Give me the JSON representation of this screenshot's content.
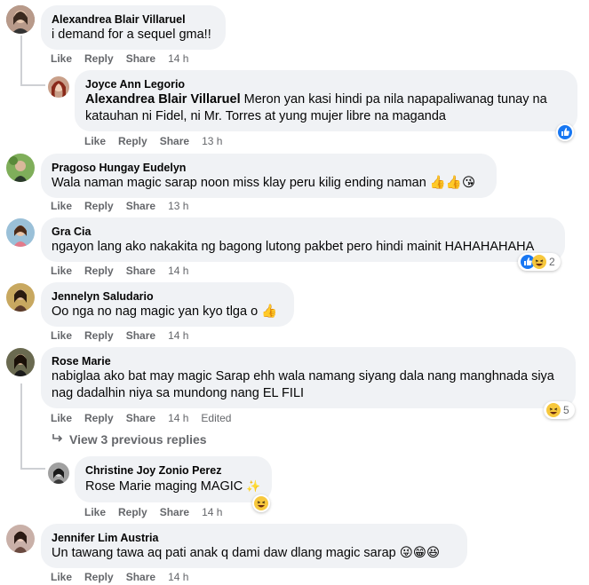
{
  "actions": {
    "like": "Like",
    "reply": "Reply",
    "share": "Share",
    "edited": "Edited"
  },
  "comments": [
    {
      "name": "Alexandrea Blair Villaruel",
      "text": "i demand for a sequel gma!!",
      "time": "14 h"
    },
    {
      "name": "Joyce Ann Legorio",
      "tag": "Alexandrea Blair Villaruel",
      "text_line1": "Meron yan kasi hindi pa nila napapaliwanag tunay na",
      "text_line2": "katauhan ni Fidel, ni Mr. Torres at yung mujer libre na maganda",
      "time": "13 h"
    },
    {
      "name": "Pragoso Hungay Eudelyn",
      "text": "Wala naman magic sarap noon miss klay peru kilig ending naman",
      "time": "13 h"
    },
    {
      "name": "Gra Cia",
      "text": "ngayon lang ako nakakita ng bagong lutong pakbet pero hindi mainit HAHAHAHAHA",
      "time": "14 h",
      "reaction_count": "2"
    },
    {
      "name": "Jennelyn Saludario",
      "text": "Oo nga no nag magic yan kyo tlga o",
      "time": "14 h"
    },
    {
      "name": "Rose Marie",
      "text_line1": "nabiglaa ako bat may magic Sarap ehh wala namang siyang dala nang manghnada siya",
      "text_line2": "nag dadalhin niya sa mundong nang EL FILI",
      "time": "14 h",
      "reaction_count": "5"
    },
    {
      "name": "Christine Joy Zonio Perez",
      "text": "Rose Marie maging MAGIC",
      "time": "14 h"
    },
    {
      "name": "Jennifer Lim Austria",
      "text": "Un tawang tawa aq pati anak q dami daw dlang magic sarap",
      "time": "14 h"
    }
  ],
  "view_replies": "View 3 previous replies",
  "colors": {
    "bubble": "#f0f2f5",
    "meta": "#65676b",
    "like_blue": "#1877f2",
    "haha_yellow": "#f7c83d"
  }
}
